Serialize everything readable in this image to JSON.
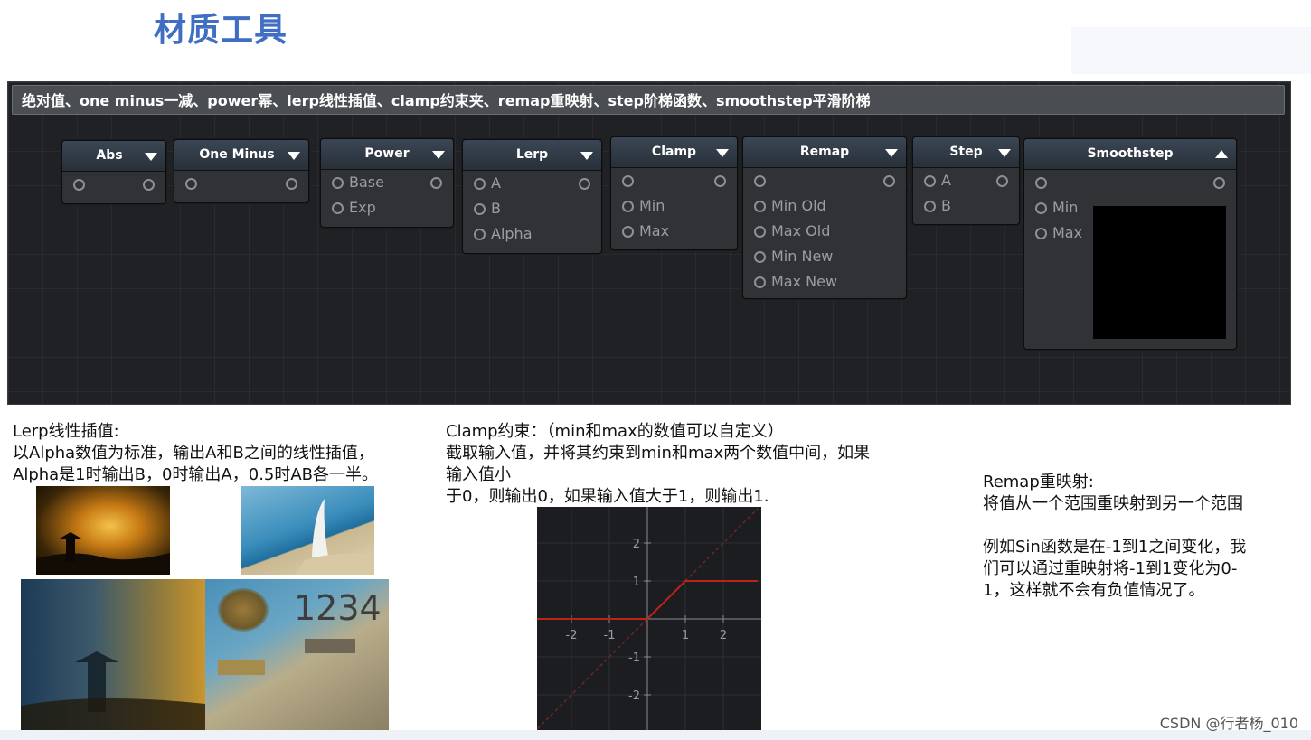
{
  "slide": {
    "title": "材质工具"
  },
  "editor": {
    "header": "绝对值、one minus一减、power幂、lerp线性插值、clamp约束夹、remap重映射、step阶梯函数、smoothstep平滑阶梯",
    "nodes": {
      "abs": {
        "title": "Abs"
      },
      "one_minus": {
        "title": "One Minus"
      },
      "power": {
        "title": "Power",
        "inputs": [
          "Base",
          "Exp"
        ]
      },
      "lerp": {
        "title": "Lerp",
        "inputs": [
          "A",
          "B",
          "Alpha"
        ]
      },
      "clamp": {
        "title": "Clamp",
        "inputs": [
          "Min",
          "Max"
        ]
      },
      "remap": {
        "title": "Remap",
        "inputs": [
          "Min Old",
          "Max Old",
          "Min New",
          "Max New"
        ]
      },
      "step": {
        "title": "Step",
        "inputs": [
          "A",
          "B"
        ]
      },
      "smoothstep": {
        "title": "Smoothstep",
        "inputs": [
          "Min",
          "Max"
        ]
      }
    }
  },
  "notes": {
    "lerp": {
      "title": "Lerp线性插值:",
      "line1": "以Alpha数值为标准，输出A和B之间的线性插值，",
      "line2": "Alpha是1时输出B，0时输出A，0.5时AB各一半。"
    },
    "clamp": {
      "title": "Clamp约束：（min和max的数值可以自定义）",
      "line1": "截取输入值，并将其约束到min和max两个数值中间，如果",
      "line2": "输入值小",
      "line3": "于0，则输出0，如果输入值大于1，则输出1."
    },
    "remap": {
      "title": "Remap重映射:",
      "line1": "将值从一个范围重映射到另一个范围",
      "line2": "例如Sin函数是在-1到1之间变化，我",
      "line3": "们可以通过重映射将-1到1变化为0-",
      "line4": "1，这样就不会有负值情况了。"
    }
  },
  "images": {
    "overlay_text": "1234"
  },
  "chart_data": {
    "type": "line",
    "title": "",
    "xlabel": "",
    "ylabel": "",
    "xlim": [
      -2.9,
      2.9
    ],
    "ylim": [
      -2.9,
      2.9
    ],
    "x_ticks": [
      "-2",
      "-1",
      "1",
      "2"
    ],
    "y_ticks": [
      "2",
      "1",
      "-1",
      "-2"
    ],
    "series": [
      {
        "x": [
          -2.9,
          0,
          1,
          2.9
        ],
        "y": [
          0,
          0,
          1,
          1
        ],
        "color": "#c0221b"
      },
      {
        "x": [
          -2.9,
          2.9
        ],
        "y": [
          -2.9,
          2.9
        ],
        "color": "#6e2622",
        "style": "dashed"
      }
    ]
  },
  "watermark": "CSDN @行者杨_010"
}
